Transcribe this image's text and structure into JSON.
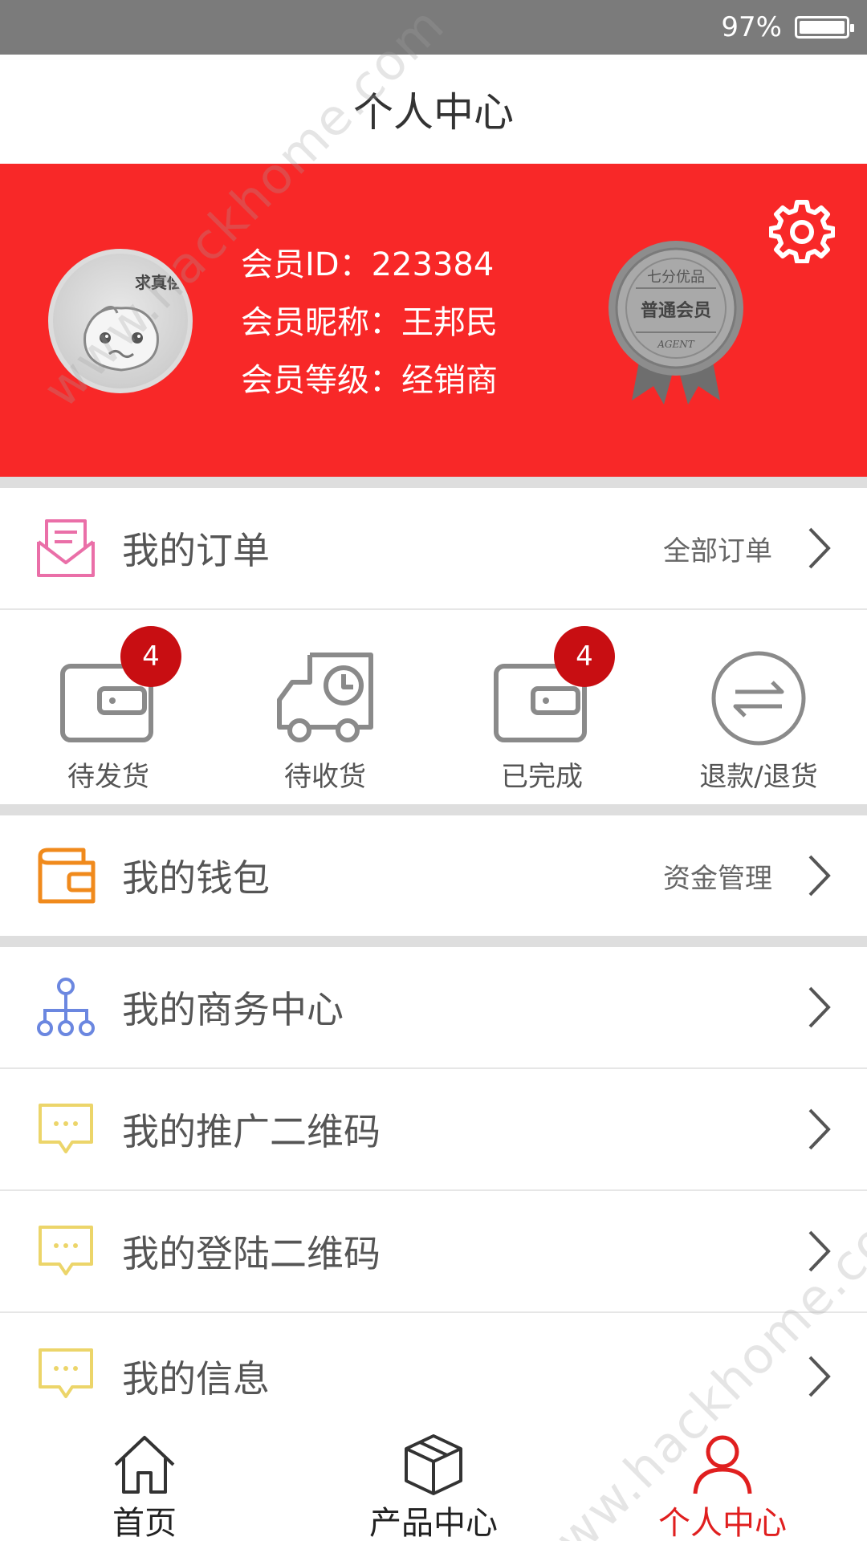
{
  "status_bar": {
    "battery_percent": "97%",
    "battery_level": 0.97
  },
  "header": {
    "title": "个人中心"
  },
  "profile": {
    "avatar_badge": "求真偿",
    "member_id_label": "会员ID：",
    "member_id": "223384",
    "nickname_label": "会员昵称：",
    "nickname": "王邦民",
    "level_label": "会员等级：",
    "level": "经销商",
    "medal": {
      "top": "七分优品",
      "middle": "普通会员",
      "bottom": "AGENT"
    }
  },
  "orders": {
    "title": "我的订单",
    "link": "全部订单",
    "statuses": [
      {
        "label": "待发货",
        "badge": "4"
      },
      {
        "label": "待收货"
      },
      {
        "label": "已完成",
        "badge": "4"
      },
      {
        "label": "退款/退货"
      }
    ]
  },
  "wallet": {
    "title": "我的钱包",
    "link": "资金管理"
  },
  "menu": [
    {
      "label": "我的商务中心"
    },
    {
      "label": "我的推广二维码"
    },
    {
      "label": "我的登陆二维码"
    },
    {
      "label": "我的信息"
    }
  ],
  "tabbar": {
    "items": [
      {
        "label": "首页"
      },
      {
        "label": "产品中心"
      },
      {
        "label": "个人中心"
      }
    ],
    "active_color": "#e01f1f"
  },
  "watermark": "www.hackhome.com",
  "colors": {
    "banner": "#f82828",
    "badge": "#c80e12"
  }
}
